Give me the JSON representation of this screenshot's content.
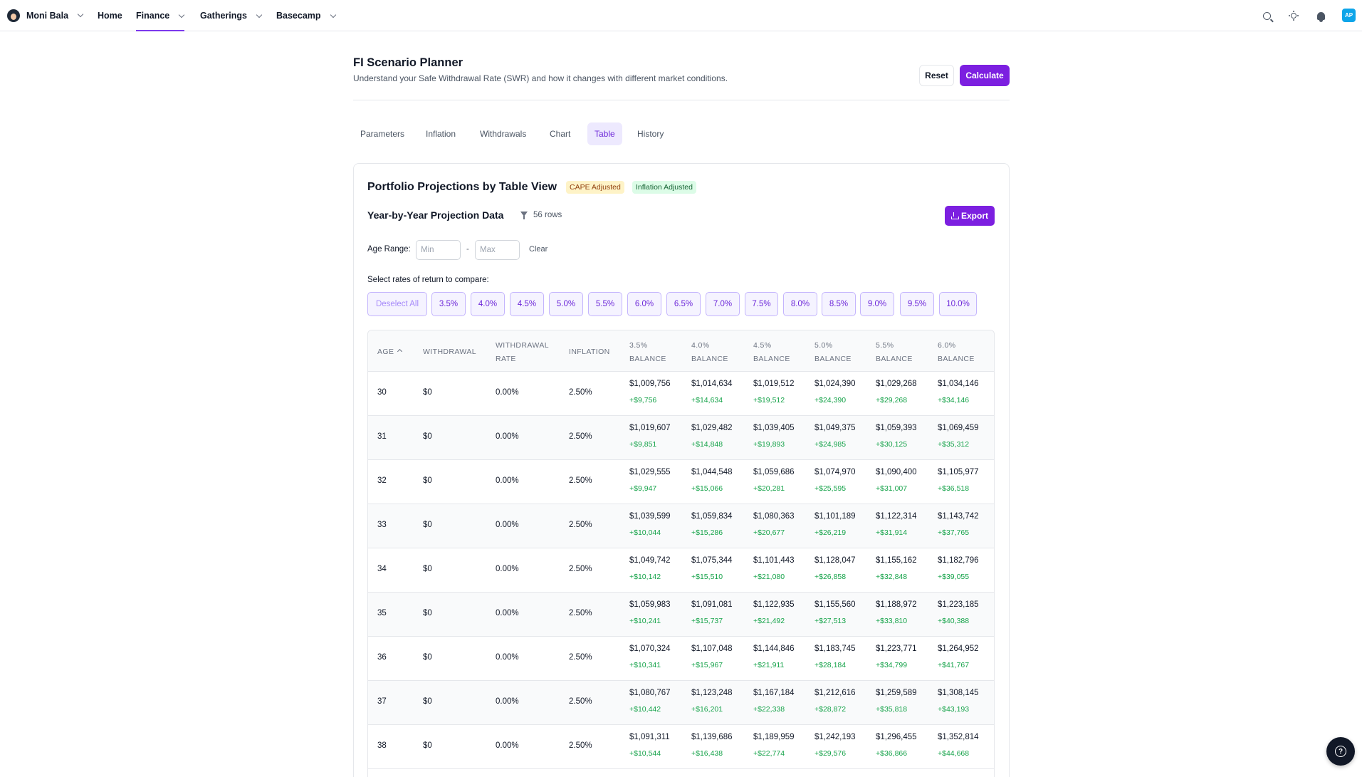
{
  "nav": {
    "user_name": "Moni Bala",
    "items": [
      {
        "label": "Home"
      },
      {
        "label": "Finance"
      },
      {
        "label": "Gatherings"
      },
      {
        "label": "Basecamp"
      }
    ],
    "user_initials": "AP"
  },
  "header": {
    "title": "FI Scenario Planner",
    "subtitle": "Understand your Safe Withdrawal Rate (SWR) and how it changes with different market conditions.",
    "reset_label": "Reset",
    "calculate_label": "Calculate"
  },
  "tabs": [
    {
      "label": "Parameters"
    },
    {
      "label": "Inflation"
    },
    {
      "label": "Withdrawals"
    },
    {
      "label": "Chart"
    },
    {
      "label": "Table"
    },
    {
      "label": "History"
    }
  ],
  "card": {
    "title": "Portfolio Projections by Table View",
    "badge_cape": "CAPE Adjusted",
    "badge_inflation": "Inflation Adjusted",
    "subtitle": "Year-by-Year Projection Data",
    "rows_count": "56 rows",
    "export_label": "Export",
    "age_range_label": "Age Range:",
    "min_placeholder": "Min",
    "max_placeholder": "Max",
    "dash": "-",
    "clear_label": "Clear",
    "rates_label": "Select rates of return to compare:",
    "deselect_label": "Deselect All",
    "rates": [
      "3.5%",
      "4.0%",
      "4.5%",
      "5.0%",
      "5.5%",
      "6.0%",
      "6.5%",
      "7.0%",
      "7.5%",
      "8.0%",
      "8.5%",
      "9.0%",
      "9.5%",
      "10.0%"
    ]
  },
  "table": {
    "headers": {
      "age": "AGE",
      "withdrawal": "WITHDRAWAL",
      "withdrawal_rate_1": "WITHDRAWAL",
      "withdrawal_rate_2": "RATE",
      "inflation": "INFLATION",
      "balance_cols": [
        {
          "rate": "3.5%",
          "label": "BALANCE"
        },
        {
          "rate": "4.0%",
          "label": "BALANCE"
        },
        {
          "rate": "4.5%",
          "label": "BALANCE"
        },
        {
          "rate": "5.0%",
          "label": "BALANCE"
        },
        {
          "rate": "5.5%",
          "label": "BALANCE"
        },
        {
          "rate": "6.0%",
          "label": "BALANCE"
        }
      ]
    },
    "rows": [
      {
        "age": "30",
        "withdrawal": "$0",
        "rate": "0.00%",
        "inflation": "2.50%",
        "balances": [
          "$1,009,756",
          "$1,014,634",
          "$1,019,512",
          "$1,024,390",
          "$1,029,268",
          "$1,034,146"
        ],
        "deltas": [
          "+$9,756",
          "+$14,634",
          "+$19,512",
          "+$24,390",
          "+$29,268",
          "+$34,146"
        ]
      },
      {
        "age": "31",
        "withdrawal": "$0",
        "rate": "0.00%",
        "inflation": "2.50%",
        "balances": [
          "$1,019,607",
          "$1,029,482",
          "$1,039,405",
          "$1,049,375",
          "$1,059,393",
          "$1,069,459"
        ],
        "deltas": [
          "+$9,851",
          "+$14,848",
          "+$19,893",
          "+$24,985",
          "+$30,125",
          "+$35,312"
        ]
      },
      {
        "age": "32",
        "withdrawal": "$0",
        "rate": "0.00%",
        "inflation": "2.50%",
        "balances": [
          "$1,029,555",
          "$1,044,548",
          "$1,059,686",
          "$1,074,970",
          "$1,090,400",
          "$1,105,977"
        ],
        "deltas": [
          "+$9,947",
          "+$15,066",
          "+$20,281",
          "+$25,595",
          "+$31,007",
          "+$36,518"
        ]
      },
      {
        "age": "33",
        "withdrawal": "$0",
        "rate": "0.00%",
        "inflation": "2.50%",
        "balances": [
          "$1,039,599",
          "$1,059,834",
          "$1,080,363",
          "$1,101,189",
          "$1,122,314",
          "$1,143,742"
        ],
        "deltas": [
          "+$10,044",
          "+$15,286",
          "+$20,677",
          "+$26,219",
          "+$31,914",
          "+$37,765"
        ]
      },
      {
        "age": "34",
        "withdrawal": "$0",
        "rate": "0.00%",
        "inflation": "2.50%",
        "balances": [
          "$1,049,742",
          "$1,075,344",
          "$1,101,443",
          "$1,128,047",
          "$1,155,162",
          "$1,182,796"
        ],
        "deltas": [
          "+$10,142",
          "+$15,510",
          "+$21,080",
          "+$26,858",
          "+$32,848",
          "+$39,055"
        ]
      },
      {
        "age": "35",
        "withdrawal": "$0",
        "rate": "0.00%",
        "inflation": "2.50%",
        "balances": [
          "$1,059,983",
          "$1,091,081",
          "$1,122,935",
          "$1,155,560",
          "$1,188,972",
          "$1,223,185"
        ],
        "deltas": [
          "+$10,241",
          "+$15,737",
          "+$21,492",
          "+$27,513",
          "+$33,810",
          "+$40,388"
        ]
      },
      {
        "age": "36",
        "withdrawal": "$0",
        "rate": "0.00%",
        "inflation": "2.50%",
        "balances": [
          "$1,070,324",
          "$1,107,048",
          "$1,144,846",
          "$1,183,745",
          "$1,223,771",
          "$1,264,952"
        ],
        "deltas": [
          "+$10,341",
          "+$15,967",
          "+$21,911",
          "+$28,184",
          "+$34,799",
          "+$41,767"
        ]
      },
      {
        "age": "37",
        "withdrawal": "$0",
        "rate": "0.00%",
        "inflation": "2.50%",
        "balances": [
          "$1,080,767",
          "$1,123,248",
          "$1,167,184",
          "$1,212,616",
          "$1,259,589",
          "$1,308,145"
        ],
        "deltas": [
          "+$10,442",
          "+$16,201",
          "+$22,338",
          "+$28,872",
          "+$35,818",
          "+$43,193"
        ]
      },
      {
        "age": "38",
        "withdrawal": "$0",
        "rate": "0.00%",
        "inflation": "2.50%",
        "balances": [
          "$1,091,311",
          "$1,139,686",
          "$1,189,959",
          "$1,242,193",
          "$1,296,455",
          "$1,352,814"
        ],
        "deltas": [
          "+$10,544",
          "+$16,438",
          "+$22,774",
          "+$29,576",
          "+$36,866",
          "+$44,668"
        ]
      }
    ]
  },
  "colors": {
    "accent": "#7c1fe0",
    "tab_active_bg": "#ede9fe",
    "positive": "#16a34a"
  },
  "icons": {
    "search": "search-icon",
    "theme": "sun-icon",
    "notifications": "bell-icon",
    "help": "help-icon",
    "export": "download-icon",
    "filter": "filter-icon"
  }
}
